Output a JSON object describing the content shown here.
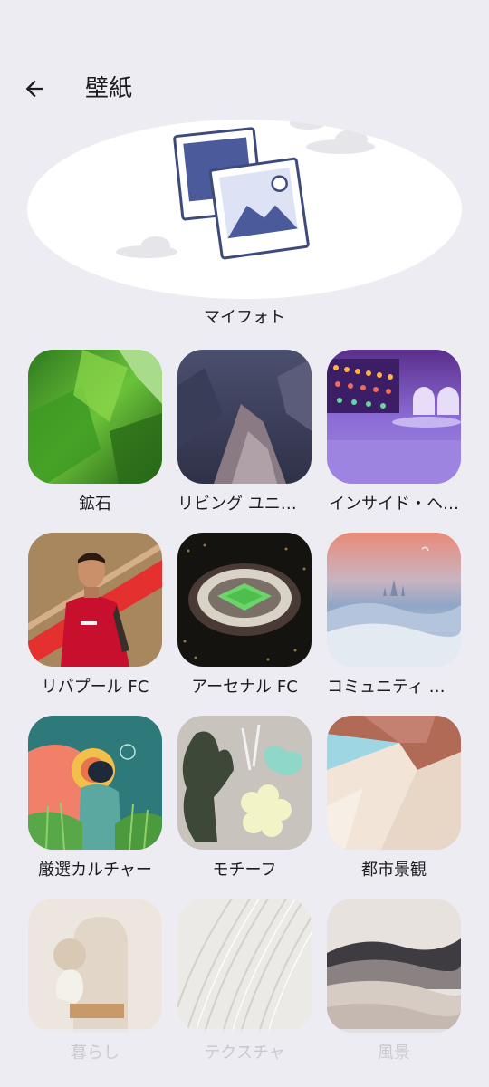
{
  "header": {
    "title": "壁紙",
    "back_icon": "arrow-back-icon"
  },
  "hero": {
    "label": "マイフォト",
    "icon": "photo-stack-icon"
  },
  "categories": [
    {
      "label": "鉱石"
    },
    {
      "label": "リビング ユニバ…"
    },
    {
      "label": "インサイド・ヘ…"
    },
    {
      "label": "リバプール FC"
    },
    {
      "label": "アーセナル FC"
    },
    {
      "label": "コミュニティ レ…"
    },
    {
      "label": "厳選カルチャー"
    },
    {
      "label": "モチーフ"
    },
    {
      "label": "都市景観"
    },
    {
      "label": "暮らし"
    },
    {
      "label": "テクスチャ"
    },
    {
      "label": "風景"
    }
  ],
  "colors": {
    "background": "#EEECF3",
    "card": "#FFFFFF",
    "text": "#1C1B1F",
    "photo_icon_fill": "#4A5A9A"
  }
}
